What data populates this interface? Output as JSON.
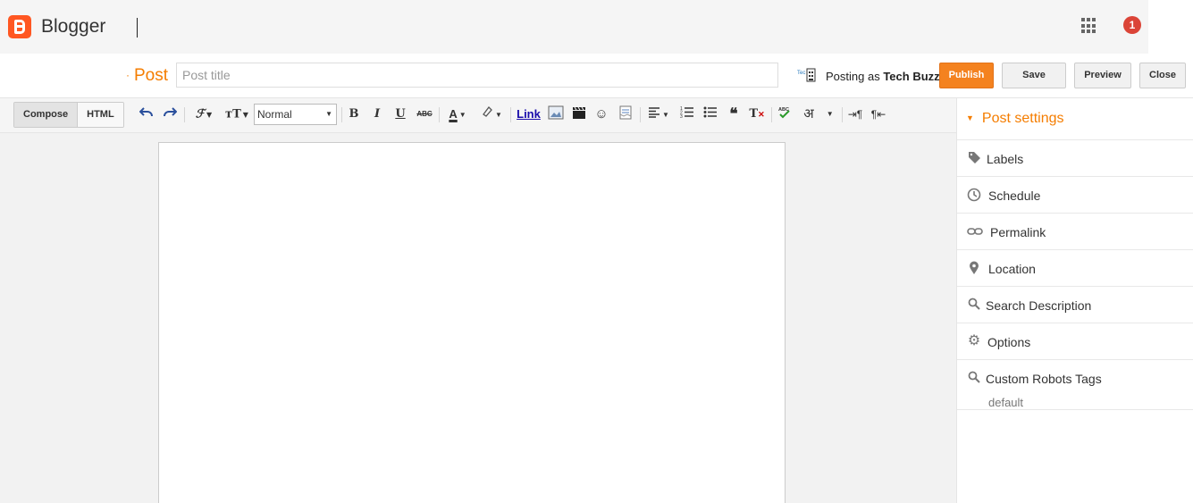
{
  "app": {
    "name": "Blogger",
    "notification_count": "1",
    "brand_color": "#ff5722"
  },
  "post": {
    "label": "Post",
    "title_placeholder": "Post title",
    "posting_as_prefix": "Posting as",
    "posting_as_name": "Tech Buzz"
  },
  "actions": {
    "publish": "Publish",
    "save": "Save",
    "preview": "Preview",
    "close": "Close"
  },
  "editor": {
    "mode_compose": "Compose",
    "mode_html": "HTML",
    "format_value": "Normal",
    "link_label": "Link",
    "icons": [
      "undo-icon",
      "redo-icon",
      "font-family-icon",
      "font-size-icon",
      "bold-icon",
      "italic-icon",
      "underline-icon",
      "strikethrough-icon",
      "text-color-icon",
      "highlight-icon",
      "link-icon",
      "insert-image-icon",
      "insert-video-icon",
      "insert-emoji-icon",
      "insert-jump-break-icon",
      "align-icon",
      "numbered-list-icon",
      "bulleted-list-icon",
      "quote-icon",
      "remove-format-icon",
      "spellcheck-icon",
      "transliterate-icon",
      "ltr-icon",
      "rtl-icon"
    ]
  },
  "sidebar": {
    "title": "Post settings",
    "items": [
      {
        "label": "Labels",
        "icon": "tag-icon"
      },
      {
        "label": "Schedule",
        "icon": "clock-icon"
      },
      {
        "label": "Permalink",
        "icon": "link-icon"
      },
      {
        "label": "Location",
        "icon": "pin-icon"
      },
      {
        "label": "Search Description",
        "icon": "search-icon"
      },
      {
        "label": "Options",
        "icon": "gear-icon"
      },
      {
        "label": "Custom Robots Tags",
        "icon": "search-icon",
        "value": "default"
      }
    ]
  },
  "colors": {
    "accent": "#f57d00",
    "publish_bg": "#f4821f",
    "notification": "#db4437"
  }
}
